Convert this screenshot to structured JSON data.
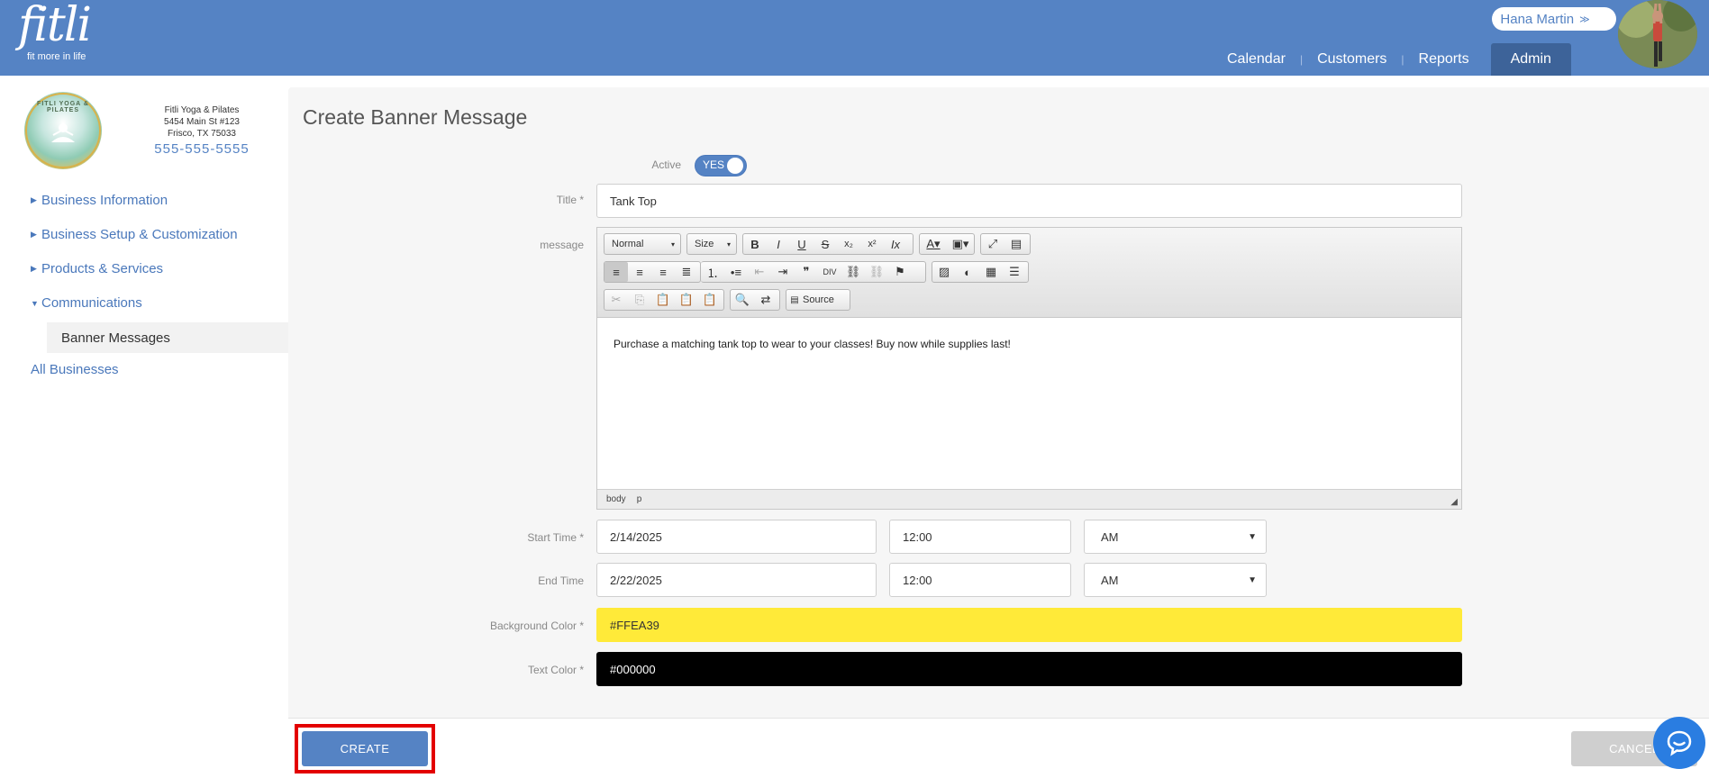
{
  "header": {
    "logo_word": "fitli",
    "logo_tagline": "fit more in life",
    "user_name": "Hana Martin",
    "nav": [
      {
        "label": "Calendar"
      },
      {
        "label": "Customers"
      },
      {
        "label": "Reports"
      },
      {
        "label": "Admin",
        "active": true
      }
    ]
  },
  "business": {
    "logo_text": "FITLI YOGA & PILATES",
    "name": "Fitli Yoga & Pilates",
    "address1": "5454 Main St #123",
    "address2": "Frisco, TX 75033",
    "phone": "555-555-5555"
  },
  "sidebar": {
    "items": [
      {
        "label": "Business Information",
        "expanded": false
      },
      {
        "label": "Business Setup & Customization",
        "expanded": false
      },
      {
        "label": "Products & Services",
        "expanded": false
      },
      {
        "label": "Communications",
        "expanded": true
      },
      {
        "label": "All Businesses"
      }
    ],
    "subitem": "Banner Messages"
  },
  "form": {
    "page_title": "Create Banner Message",
    "active_label": "Active",
    "active_value": "YES",
    "title_label": "Title *",
    "title_value": "Tank Top",
    "message_label": "message",
    "editor": {
      "format_combo": "Normal",
      "size_combo": "Size",
      "source_label": "Source",
      "content": "Purchase a matching tank top to wear to your classes! Buy now while supplies last!",
      "path_body": "body",
      "path_p": "p"
    },
    "start_label": "Start Time *",
    "start_date": "2/14/2025",
    "start_time": "12:00",
    "start_ampm": "AM",
    "end_label": "End Time",
    "end_date": "2/22/2025",
    "end_time": "12:00",
    "end_ampm": "AM",
    "bg_label": "Background Color *",
    "bg_value": "#FFEA39",
    "text_label": "Text Color *",
    "text_value": "#000000"
  },
  "actions": {
    "create": "CREATE",
    "cancel": "CANCEL"
  },
  "colors": {
    "brand_blue": "#5583c4",
    "bg_color_swatch": "#FFEA39",
    "text_color_swatch": "#000000",
    "highlight": "#e30000"
  }
}
